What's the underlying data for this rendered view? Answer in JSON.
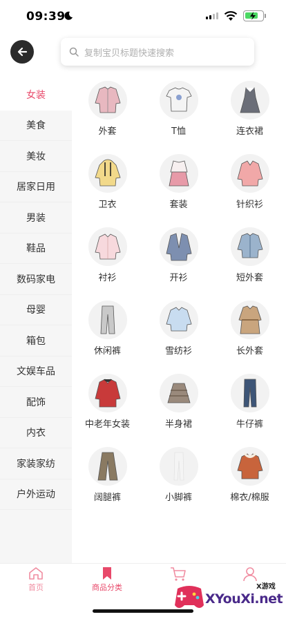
{
  "status": {
    "time": "09:39"
  },
  "search": {
    "placeholder": "复制宝贝标题快速搜索"
  },
  "sidebar": {
    "items": [
      {
        "label": "女装",
        "active": true
      },
      {
        "label": "美食"
      },
      {
        "label": "美妆"
      },
      {
        "label": "居家日用"
      },
      {
        "label": "男装"
      },
      {
        "label": "鞋品"
      },
      {
        "label": "数码家电"
      },
      {
        "label": "母婴"
      },
      {
        "label": "箱包"
      },
      {
        "label": "文娱车品"
      },
      {
        "label": "配饰"
      },
      {
        "label": "内衣"
      },
      {
        "label": "家装家纺"
      },
      {
        "label": "户外运动"
      }
    ]
  },
  "categories": [
    {
      "label": "外套",
      "icon": "pink-jacket-icon",
      "color": "#e8b8c0"
    },
    {
      "label": "T恤",
      "icon": "tshirt-icon",
      "color": "#f4f4f4"
    },
    {
      "label": "连衣裙",
      "icon": "dress-icon",
      "color": "#6b6e78"
    },
    {
      "label": "卫衣",
      "icon": "hoodie-icon",
      "color": "#f2d98a"
    },
    {
      "label": "套装",
      "icon": "outfit-set-icon",
      "color": "#e79aa8"
    },
    {
      "label": "针织衫",
      "icon": "knit-sweater-icon",
      "color": "#f1a8a8"
    },
    {
      "label": "衬衫",
      "icon": "shirt-icon",
      "color": "#f7d9dd"
    },
    {
      "label": "开衫",
      "icon": "cardigan-icon",
      "color": "#7d8fb0"
    },
    {
      "label": "短外套",
      "icon": "denim-jacket-icon",
      "color": "#9bb3cc"
    },
    {
      "label": "休闲裤",
      "icon": "casual-pants-icon",
      "color": "#c9c9c9"
    },
    {
      "label": "雪纺衫",
      "icon": "chiffon-blouse-icon",
      "color": "#c8dcf0"
    },
    {
      "label": "长外套",
      "icon": "trench-coat-icon",
      "color": "#c9a57e"
    },
    {
      "label": "中老年女装",
      "icon": "mature-coat-icon",
      "color": "#c83a3a"
    },
    {
      "label": "半身裙",
      "icon": "skirt-icon",
      "color": "#9a8a7c"
    },
    {
      "label": "牛仔裤",
      "icon": "jeans-icon",
      "color": "#3d5577"
    },
    {
      "label": "阔腿裤",
      "icon": "wide-pants-icon",
      "color": "#8a7a62"
    },
    {
      "label": "小脚裤",
      "icon": "skinny-pants-icon",
      "color": "#ffffff"
    },
    {
      "label": "棉衣/棉服",
      "icon": "padded-coat-icon",
      "color": "#c8643c"
    }
  ],
  "tabbar": {
    "items": [
      {
        "label": "首页",
        "icon": "home-icon"
      },
      {
        "label": "商品分类",
        "icon": "bookmark-icon",
        "active": true
      },
      {
        "label": "",
        "icon": "cart-icon"
      },
      {
        "label": "",
        "icon": "user-icon"
      }
    ]
  },
  "watermark": {
    "text": "XYouXi.net",
    "small": "X游戏"
  },
  "colors": {
    "accent": "#e8496a",
    "accent_light": "#f08ca0",
    "sidebar_bg": "#f6f6f6"
  }
}
